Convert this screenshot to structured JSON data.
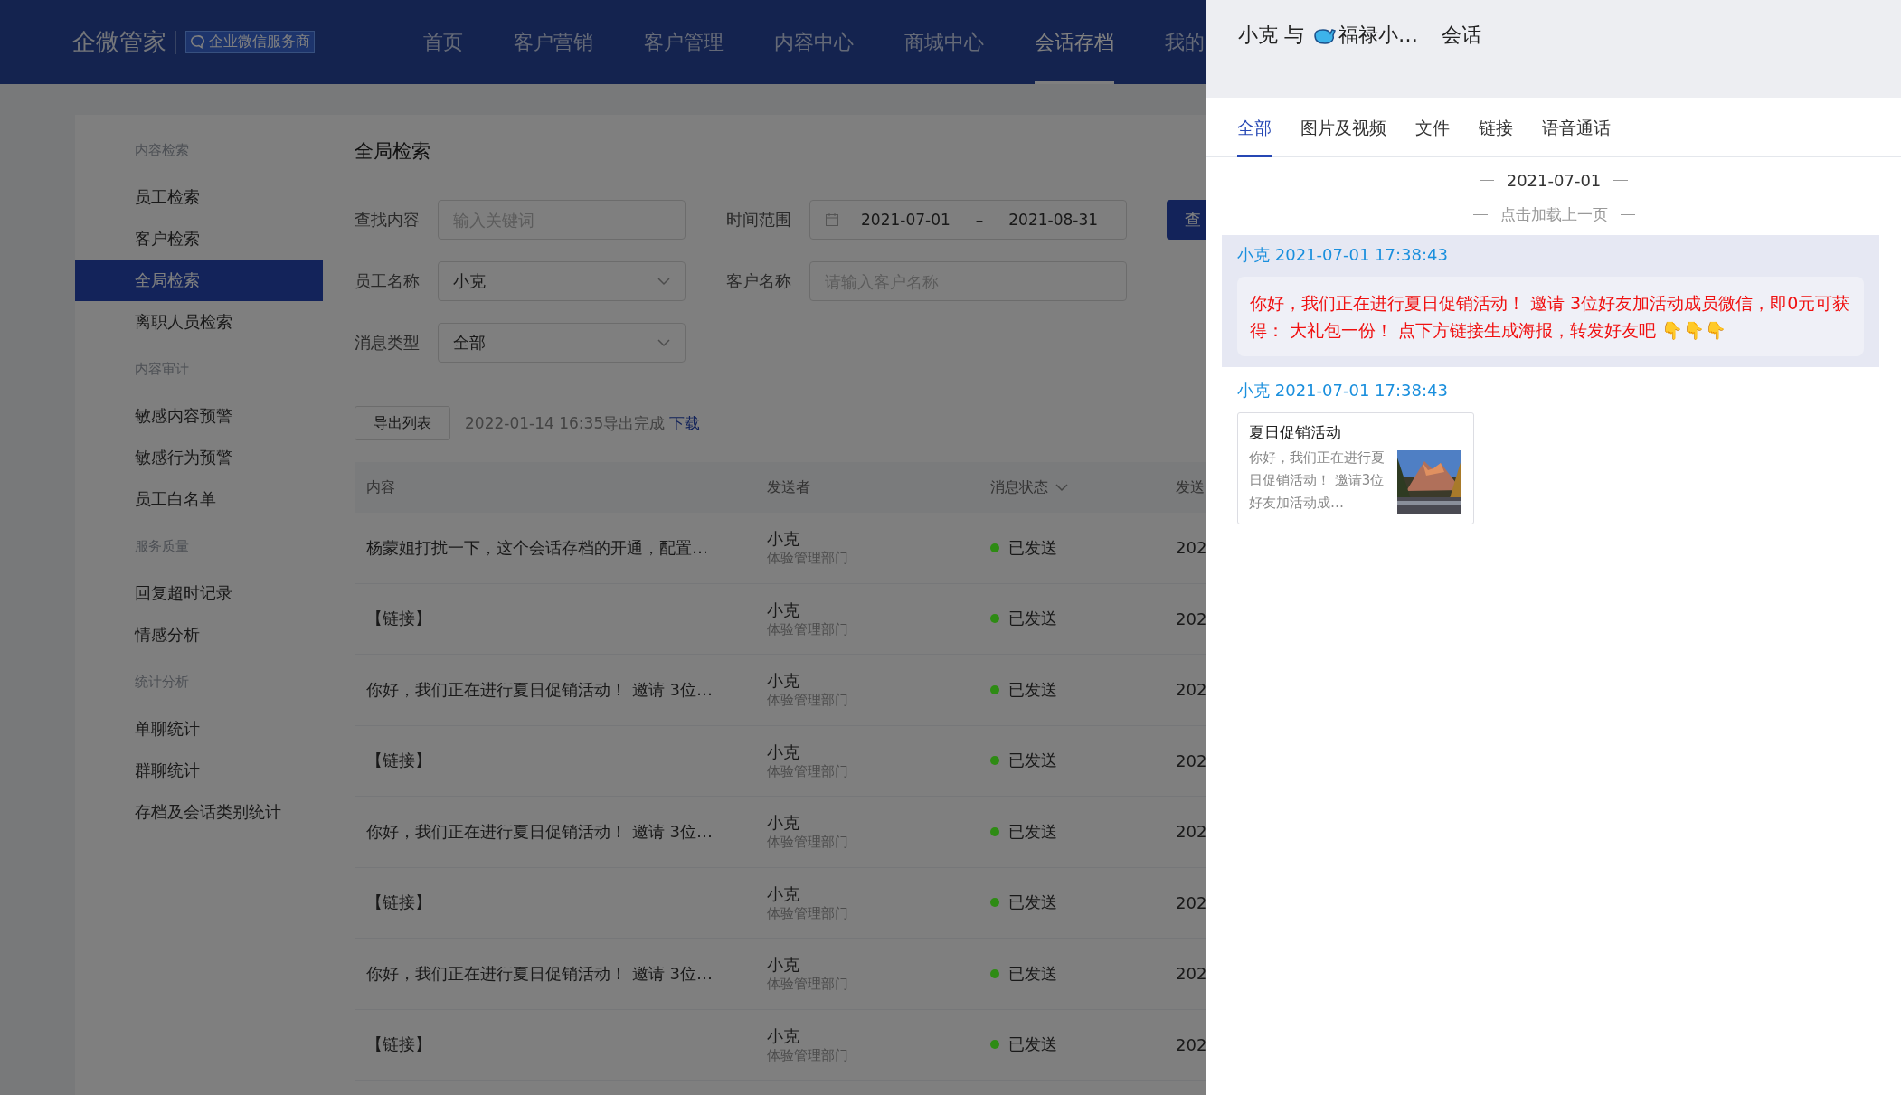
{
  "header": {
    "brand": "企微管家",
    "badge": "企业微信服务商",
    "nav": [
      {
        "label": "首页",
        "selected": false
      },
      {
        "label": "客户营销",
        "selected": false
      },
      {
        "label": "客户管理",
        "selected": false
      },
      {
        "label": "内容中心",
        "selected": false
      },
      {
        "label": "商城中心",
        "selected": false
      },
      {
        "label": "会话存档",
        "selected": true
      },
      {
        "label": "我的",
        "selected": false
      }
    ]
  },
  "sidebar": {
    "groups": [
      {
        "title": "内容检索",
        "items": [
          {
            "label": "员工检索",
            "selected": false
          },
          {
            "label": "客户检索",
            "selected": false
          },
          {
            "label": "全局检索",
            "selected": true
          },
          {
            "label": "离职人员检索",
            "selected": false
          }
        ]
      },
      {
        "title": "内容审计",
        "items": [
          {
            "label": "敏感内容预警",
            "selected": false
          },
          {
            "label": "敏感行为预警",
            "selected": false
          },
          {
            "label": "员工白名单",
            "selected": false
          }
        ]
      },
      {
        "title": "服务质量",
        "items": [
          {
            "label": "回复超时记录",
            "selected": false
          },
          {
            "label": "情感分析",
            "selected": false
          }
        ]
      },
      {
        "title": "统计分析",
        "items": [
          {
            "label": "单聊统计",
            "selected": false
          },
          {
            "label": "群聊统计",
            "selected": false
          },
          {
            "label": "存档及会话类别统计",
            "selected": false
          }
        ]
      }
    ]
  },
  "page": {
    "title": "全局检索",
    "form": {
      "keyword": {
        "label": "查找内容",
        "placeholder": "输入关键词"
      },
      "time_range": {
        "label": "时间范围",
        "start": "2021-07-01",
        "separator": "–",
        "end": "2021-08-31"
      },
      "employee": {
        "label": "员工名称",
        "value": "小克"
      },
      "customer": {
        "label": "客户名称",
        "placeholder": "请输入客户名称"
      },
      "message_type": {
        "label": "消息类型",
        "value": "全部"
      },
      "search_button": "查"
    },
    "export": {
      "button": "导出列表",
      "status": "2022-01-14 16:35导出完成",
      "link": "下载"
    },
    "table": {
      "columns": [
        "内容",
        "发送者",
        "消息状态",
        "发送"
      ],
      "rows": [
        {
          "content": "杨蒙姐打扰一下，这个会话存档的开通，配置…",
          "sender": "小克",
          "department": "体验管理部门",
          "status": "已发送",
          "color": "#2e8b14",
          "column_4": "202"
        },
        {
          "content": "【链接】",
          "sender": "小克",
          "department": "体验管理部门",
          "status": "已发送",
          "color": "#2e8b14",
          "column_4": "202"
        },
        {
          "content": "你好，我们正在进行夏日促销活动！ 邀请 3位…",
          "sender": "小克",
          "department": "体验管理部门",
          "status": "已发送",
          "color": "#2e8b14",
          "column_4": "202"
        },
        {
          "content": "【链接】",
          "sender": "小克",
          "department": "体验管理部门",
          "status": "已发送",
          "color": "#2e8b14",
          "column_4": "202"
        },
        {
          "content": "你好，我们正在进行夏日促销活动！ 邀请 3位…",
          "sender": "小克",
          "department": "体验管理部门",
          "status": "已发送",
          "color": "#2e8b14",
          "column_4": "202"
        },
        {
          "content": "【链接】",
          "sender": "小克",
          "department": "体验管理部门",
          "status": "已发送",
          "color": "#2e8b14",
          "column_4": "202"
        },
        {
          "content": "你好，我们正在进行夏日促销活动！ 邀请 3位…",
          "sender": "小克",
          "department": "体验管理部门",
          "status": "已发送",
          "color": "#2e8b14",
          "column_4": "202"
        },
        {
          "content": "【链接】",
          "sender": "小克",
          "department": "体验管理部门",
          "status": "已发送",
          "color": "#2e8b14",
          "column_4": "202"
        }
      ]
    }
  },
  "drawer": {
    "title": {
      "person": "小克",
      "connector": "与",
      "contact": "福禄小…",
      "suffix": "会话"
    },
    "tabs": [
      {
        "label": "全部",
        "selected": true
      },
      {
        "label": "图片及视频",
        "selected": false
      },
      {
        "label": "文件",
        "selected": false
      },
      {
        "label": "链接",
        "selected": false
      },
      {
        "label": "语音通话",
        "selected": false
      }
    ],
    "date": "2021-07-01",
    "load_more": "点击加载上一页",
    "messages": [
      {
        "kind": "text",
        "selected": true,
        "author": "小克 2021-07-01 17:38:43",
        "text": "你好，我们正在进行夏日促销活动！ 邀请 3位好友加活动成员微信，即0元可获得： 大礼包一份！ 点下方链接生成海报，转发好友吧 👇👇👇"
      },
      {
        "kind": "link",
        "selected": false,
        "author": "小克 2021-07-01 17:38:43",
        "title": "夏日促销活动",
        "description": "你好，我们正在进行夏日促销活动！ 邀请3位好友加活动成…"
      }
    ]
  }
}
